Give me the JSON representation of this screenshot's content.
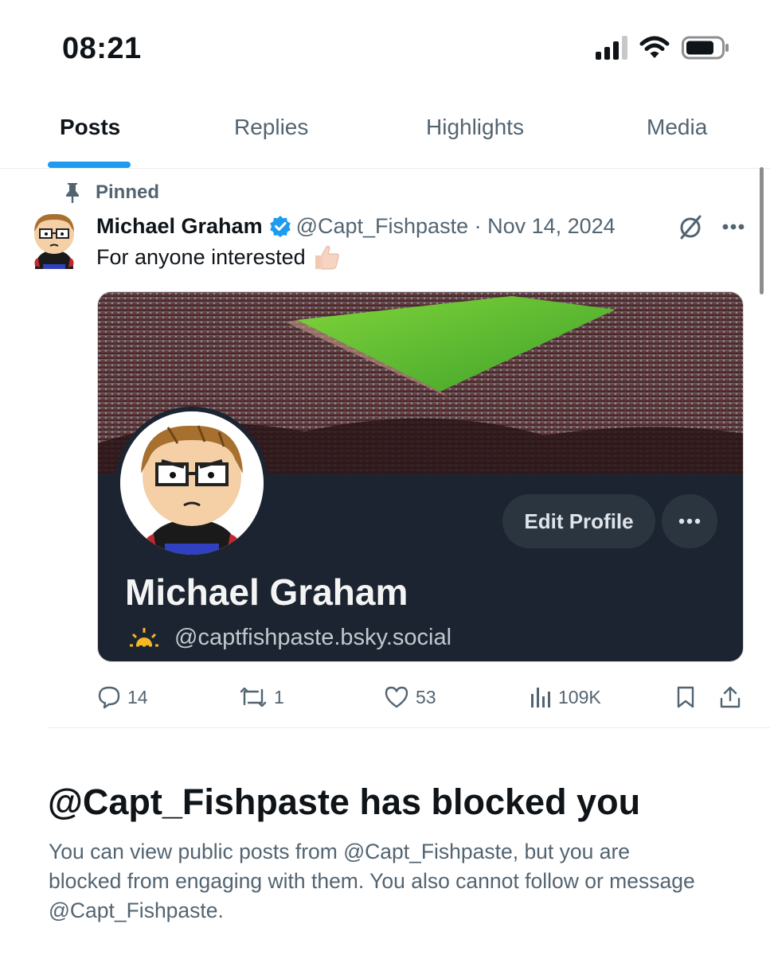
{
  "status_bar": {
    "time": "08:21",
    "icons": [
      "cellular-signal-icon",
      "wifi-icon",
      "battery-icon"
    ]
  },
  "tabs": [
    {
      "label": "Posts",
      "active": true
    },
    {
      "label": "Replies",
      "active": false
    },
    {
      "label": "Highlights",
      "active": false
    },
    {
      "label": "Media",
      "active": false
    }
  ],
  "post": {
    "pinned_label": "Pinned",
    "author_name": "Michael Graham",
    "verified": true,
    "meta": "@Capt_Fishpaste · Nov 14, 2024",
    "text": "For anyone interested",
    "text_emoji": "thumbs-up-icon",
    "media": {
      "name": "Michael Graham",
      "handle": "@captfishpaste.bsky.social",
      "edit_profile_label": "Edit Profile"
    },
    "engagement": {
      "replies": "14",
      "reposts": "1",
      "likes": "53",
      "views": "109K"
    }
  },
  "blocked": {
    "title": "@Capt_Fishpaste has blocked you",
    "description": "You can view public posts from @Capt_Fishpaste, but you are blocked from engaging with them. You also cannot follow or message @Capt_Fishpaste."
  },
  "colors": {
    "accent": "#1d9bf0",
    "text_primary": "#0f1419",
    "text_secondary": "#536471",
    "card_background": "#1b2430"
  }
}
